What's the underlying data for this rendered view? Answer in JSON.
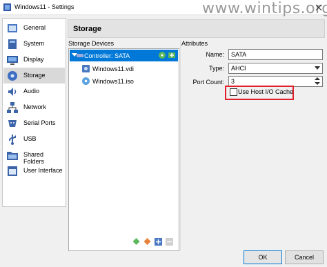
{
  "window": {
    "title": "Windows11 - Settings",
    "watermark": "www.wintips.org"
  },
  "sidebar": {
    "items": [
      {
        "label": "General",
        "icon": "general-icon"
      },
      {
        "label": "System",
        "icon": "system-icon"
      },
      {
        "label": "Display",
        "icon": "display-icon"
      },
      {
        "label": "Storage",
        "icon": "storage-icon",
        "selected": true
      },
      {
        "label": "Audio",
        "icon": "audio-icon"
      },
      {
        "label": "Network",
        "icon": "network-icon"
      },
      {
        "label": "Serial Ports",
        "icon": "serial-ports-icon"
      },
      {
        "label": "USB",
        "icon": "usb-icon"
      },
      {
        "label": "Shared Folders",
        "icon": "shared-folders-icon"
      },
      {
        "label": "User Interface",
        "icon": "user-interface-icon"
      }
    ]
  },
  "main": {
    "title": "Storage",
    "storage_devices": {
      "label": "Storage Devices",
      "controller": "Controller: SATA",
      "items": [
        {
          "label": "Windows11.vdi",
          "icon": "hard-disk-icon"
        },
        {
          "label": "Windows11.iso",
          "icon": "optical-disk-icon"
        }
      ]
    },
    "attributes": {
      "label": "Attributes",
      "name_label": "Name:",
      "name_value": "SATA",
      "type_label": "Type:",
      "type_value": "AHCI",
      "port_count_label": "Port Count:",
      "port_count_value": "3",
      "host_io_cache_label": "Use Host I/O Cache",
      "host_io_cache_checked": false
    }
  },
  "footer": {
    "ok_label": "OK",
    "cancel_label": "Cancel"
  },
  "colors": {
    "accent": "#0078d7",
    "highlight": "#e0212b"
  }
}
